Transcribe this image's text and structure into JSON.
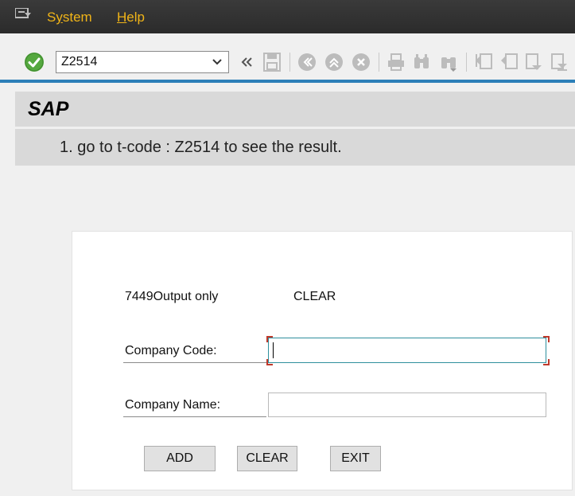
{
  "menubar": {
    "system_icon": "system-menu-icon",
    "items": [
      {
        "label": "System",
        "underline": "y",
        "before": "S",
        "after": "stem"
      },
      {
        "label": "Help",
        "underline": "H",
        "before": "",
        "after": "elp"
      }
    ]
  },
  "toolbar": {
    "command_value": "Z2514",
    "icons": [
      "enter-check-icon",
      "dropdown-chevron-icon",
      "collapse-double-chevron-icon",
      "save-icon",
      "back-icon",
      "exit-icon",
      "cancel-icon",
      "print-icon",
      "find-icon",
      "find-next-icon",
      "first-page-icon",
      "previous-page-icon",
      "next-page-icon",
      "last-page-icon"
    ]
  },
  "title": "SAP",
  "message": "1. go to t-code : Z2514 to see the result.",
  "screen": {
    "output_text": "7449Output only",
    "clear_text": "CLEAR",
    "company_code_label": "Company Code:",
    "company_code_value": "",
    "company_name_label": "Company Name:",
    "company_name_value": "",
    "buttons": {
      "add": "ADD",
      "clear": "CLEAR",
      "exit": "EXIT"
    }
  },
  "colors": {
    "menubar_bg": "#2b2b2b",
    "menu_text": "#f0b418",
    "accent_line": "#2c7fb8",
    "check_green": "#55a83f",
    "title_bg": "#d9d9d9",
    "focus_corner": "#c0392b"
  }
}
